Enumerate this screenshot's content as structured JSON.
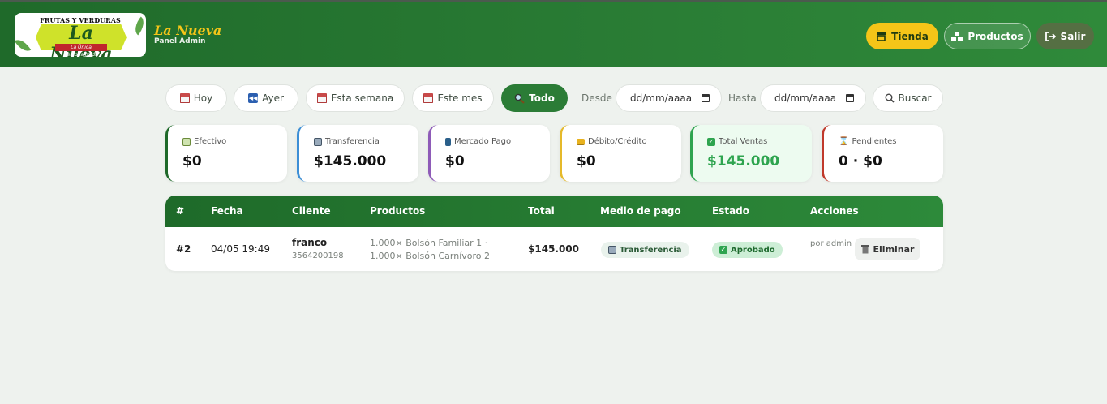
{
  "header": {
    "logo": {
      "top_text": "FRUTAS Y VERDURAS",
      "script": "La Nueva",
      "ribbon": "La Única Personalizada"
    },
    "brand_name": "La Nueva",
    "brand_subtitle": "Panel Admin",
    "buttons": {
      "store": "Tienda",
      "products": "Productos",
      "exit": "Salir"
    }
  },
  "filters": {
    "today": "Hoy",
    "yesterday": "Ayer",
    "this_week": "Esta semana",
    "this_month": "Este mes",
    "all": "Todo",
    "from_label": "Desde",
    "to_label": "Hasta",
    "from_placeholder": "dd/mm/aaaa",
    "to_placeholder": "dd/mm/aaaa",
    "search": "Buscar"
  },
  "summary": [
    {
      "label": "Efectivo",
      "value": "$0",
      "accent": "#1f6a2a"
    },
    {
      "label": "Transferencia",
      "value": "$145.000",
      "accent": "#3d8fd6"
    },
    {
      "label": "Mercado Pago",
      "value": "$0",
      "accent": "#8e5bb8"
    },
    {
      "label": "Débito/Crédito",
      "value": "$0",
      "accent": "#e5b92a"
    },
    {
      "label": "Total Ventas",
      "value": "$145.000",
      "accent": "#2ea44f"
    },
    {
      "label": "Pendientes",
      "value": "0 · $0",
      "accent": "#c0392b"
    }
  ],
  "table": {
    "headers": [
      "#",
      "Fecha",
      "Cliente",
      "Productos",
      "Total",
      "Medio de pago",
      "Estado",
      "Acciones"
    ],
    "rows": [
      {
        "id": "#2",
        "date": "04/05 19:49",
        "client": "franco",
        "phone": "3564200198",
        "products_line1": "1.000× Bolsón Familiar 1 ·",
        "products_line2": "1.000× Bolsón Carnívoro 2",
        "total": "$145.000",
        "payment": "Transferencia",
        "status": "Aprobado",
        "by": "por admin",
        "delete": "Eliminar"
      }
    ]
  },
  "colors": {
    "header_green": "#2a7d35",
    "accent_yellow": "#f5c518",
    "approved_bg": "#d6f2dd",
    "total_green": "#2ea44f"
  }
}
